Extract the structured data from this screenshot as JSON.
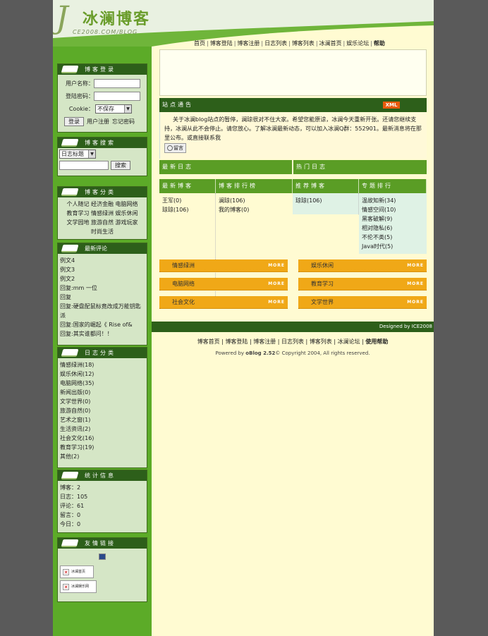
{
  "header": {
    "logo_initial": "J",
    "logo_title": "冰澜博客",
    "logo_url": "CE2008.COM/BLOG",
    "nav": [
      "首页",
      "博客登陆",
      "博客注册",
      "日志列表",
      "博客列表",
      "冰澜首页",
      "娱乐论坛",
      "帮助"
    ]
  },
  "login": {
    "title": "博客登录",
    "username_label": "用户名称：",
    "password_label": "登陆密码：",
    "cookie_label": "Cookie：",
    "cookie_value": "不保存",
    "login_button": "登录",
    "register_link": "用户注册",
    "forgot_link": "忘记密码"
  },
  "search": {
    "title": "博客搜索",
    "select_value": "日志标题",
    "button": "搜索"
  },
  "categories": {
    "title": "博客分类",
    "items": [
      "个人随记",
      "经济金融",
      "电脑网络",
      "教育学习",
      "情感绿洲",
      "娱乐休闲",
      "文学园地",
      "旅游自然",
      "游戏玩家",
      "时尚生活"
    ]
  },
  "comments": {
    "title": "最新评论",
    "items": [
      "例文4",
      "例文3",
      "例文2",
      "回复:mm 一位",
      "回复",
      "回复:硬盘配鼠标竟改成万能钥匙 派",
      "回复:国家的崛起《 Rise of&",
      "回复:其实谁都问！！"
    ]
  },
  "log_categories": {
    "title": "日志分类",
    "items": [
      "情感绿洲(18)",
      "娱乐休闲(12)",
      "电脑网络(35)",
      "新闻出版(0)",
      "文学世界(0)",
      "旅游自然(0)",
      "艺术之窗(1)",
      "生活资讯(2)",
      "社会文化(16)",
      "教育学习(19)",
      "其他(2)"
    ]
  },
  "stats": {
    "title": "统计信息",
    "items": [
      "博客：2",
      "日志：105",
      "评论：61",
      "留言：0",
      "今日：0"
    ]
  },
  "links": {
    "title": "友情链接",
    "items": [
      "冰澜首页",
      "冰澜娱乐网"
    ]
  },
  "notice": {
    "title": "站点通告",
    "xml": "XML",
    "text": "关于冰澜blog站点的暂停，澜琼很对不住大家。希望您能原谅，冰澜今天重新开张。还请您继续支持，冰澜从此不会停止。请您放心。了解冰澜最新动态，可以加入冰澜Q群：552901。最新消息将在那里公布。或直接联系我",
    "msg_button": "留言"
  },
  "sections": {
    "latest_logs": "最新日志",
    "hot_logs": "热门日志",
    "latest_blogs": "最新博客",
    "blog_rank": "博客排行榜",
    "recommended": "推荐博客",
    "topic_rank": "专题排行"
  },
  "latest_blogs": [
    "王军(0)",
    "琼琼(106)"
  ],
  "blog_rank": [
    "澜琼(106)",
    "我的博客(0)"
  ],
  "recommended": [
    "琼琼(106)"
  ],
  "topics": [
    "温故知新(34)",
    "情感空间(10)",
    "黑客破解(9)",
    "相对隐私(6)",
    "不伦不类(5)",
    "Java时代(5)"
  ],
  "tags": [
    {
      "label": "情感绿洲",
      "more": "MORE"
    },
    {
      "label": "娱乐休闲",
      "more": "MORE"
    },
    {
      "label": "电脑网络",
      "more": "MORE"
    },
    {
      "label": "教育学习",
      "more": "MORE"
    },
    {
      "label": "社会文化",
      "more": "MORE"
    },
    {
      "label": "文学世界",
      "more": "MORE"
    }
  ],
  "footer": {
    "designed": "Designed by ICE2008",
    "nav": [
      "博客首页",
      "博客登陆",
      "博客注册",
      "日志列表",
      "博客列表",
      "冰澜论坛",
      "使用帮助"
    ],
    "powered_prefix": "Powered by ",
    "powered_brand": "oBlog 2.52",
    "powered_suffix": "© Copyright 2004, All rights reserved."
  },
  "colors": {
    "dark_green": "#2d5f1a",
    "mid_green": "#5a9d25",
    "cream": "#fffbd2",
    "orange": "#f0a817"
  }
}
